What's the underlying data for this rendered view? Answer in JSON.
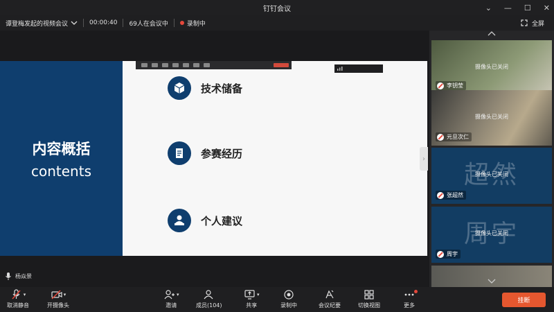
{
  "window": {
    "title": "钉钉会议",
    "controls": [
      "⌄",
      "—",
      "☐",
      "✕"
    ]
  },
  "info": {
    "meeting_name": "谭登梅发起的视频会议",
    "timer": "00:00:40",
    "participants_in_meeting": "69人在会议中",
    "recording": "录制中",
    "fullscreen": "全屏"
  },
  "slide": {
    "title_zh": "内容概括",
    "title_en": "contents",
    "items": [
      {
        "label": "技术储备",
        "icon": "cube-icon"
      },
      {
        "label": "参赛经历",
        "icon": "document-icon"
      },
      {
        "label": "个人建议",
        "icon": "person-computer-icon"
      }
    ]
  },
  "speaker": {
    "name": "杨焱景"
  },
  "participants": [
    {
      "name": "李钥莹",
      "status": "摄像头已关闭",
      "bg": "#6f7d5e"
    },
    {
      "name": "元旦次仁",
      "status": "摄像头已关闭",
      "bg": "#7a776c"
    },
    {
      "name": "张超然",
      "status": "摄像头已关闭",
      "big": "超然",
      "bg": "#123d63"
    },
    {
      "name": "周宇",
      "status": "摄像头已关闭",
      "big": "周宇",
      "bg": "#123d63"
    }
  ],
  "toolbar": {
    "unmute": "取消静音",
    "camera": "开摄像头",
    "invite": "邀请",
    "members": "成员(104)",
    "share": "共享",
    "recording": "录制中",
    "minutes": "会议纪要",
    "switch_view": "切换视图",
    "more": "更多",
    "hangup": "挂断"
  },
  "colors": {
    "accent": "#e5572f",
    "slide_blue": "#0f3e6e",
    "record_red": "#e5483b"
  }
}
